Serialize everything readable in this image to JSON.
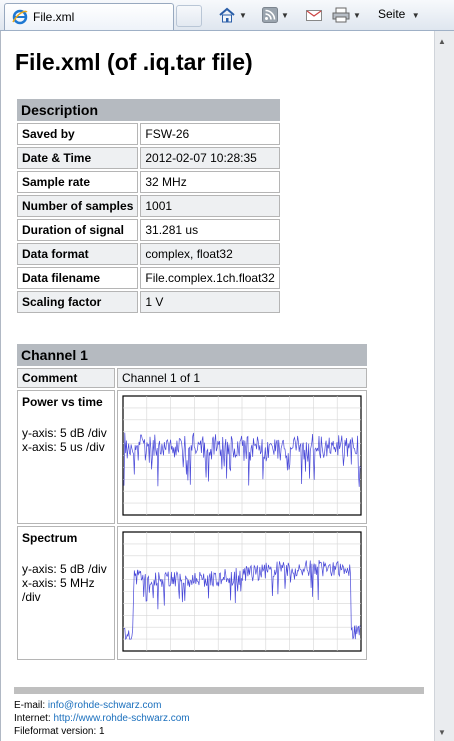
{
  "browser": {
    "tab_title": "File.xml",
    "toolbar": {
      "page_menu_label": "Seite"
    }
  },
  "page": {
    "title": "File.xml (of .iq.tar file)",
    "description": {
      "header": "Description",
      "rows": [
        {
          "label": "Saved by",
          "value": "FSW-26"
        },
        {
          "label": "Date & Time",
          "value": "2012-02-07  10:28:35"
        },
        {
          "label": "Sample rate",
          "value": "32 MHz"
        },
        {
          "label": "Number of samples",
          "value": "1001"
        },
        {
          "label": "Duration of signal",
          "value": "31.281 us"
        },
        {
          "label": "Data format",
          "value": "complex, float32"
        },
        {
          "label": "Data filename",
          "value": "File.complex.1ch.float32"
        },
        {
          "label": "Scaling factor",
          "value": "1 V"
        }
      ]
    },
    "channel": {
      "header": "Channel 1",
      "comment_label": "Comment",
      "comment_value": "Channel 1 of 1",
      "power": {
        "title": "Power vs time",
        "yaxis": "y-axis: 5 dB /div",
        "xaxis": "x-axis: 5 us /div",
        "trace_color": "#4848d8"
      },
      "spectrum": {
        "title": "Spectrum",
        "yaxis": "y-axis: 5 dB /div",
        "xaxis": "x-axis: 5 MHz /div",
        "trace_color": "#4848d8"
      }
    },
    "footer": {
      "email_label": "E-mail:",
      "email": "info@rohde-schwarz.com",
      "internet_label": "Internet:",
      "internet": "http://www.rohde-schwarz.com",
      "version": "Fileformat version: 1"
    }
  },
  "icons": [
    "ie-icon",
    "home-icon",
    "rss-icon",
    "mail-icon",
    "print-icon"
  ],
  "colors": {
    "header_bg": "#b5bac0",
    "alt_row_bg": "#eef0f2",
    "link": "#1a6fbd"
  }
}
